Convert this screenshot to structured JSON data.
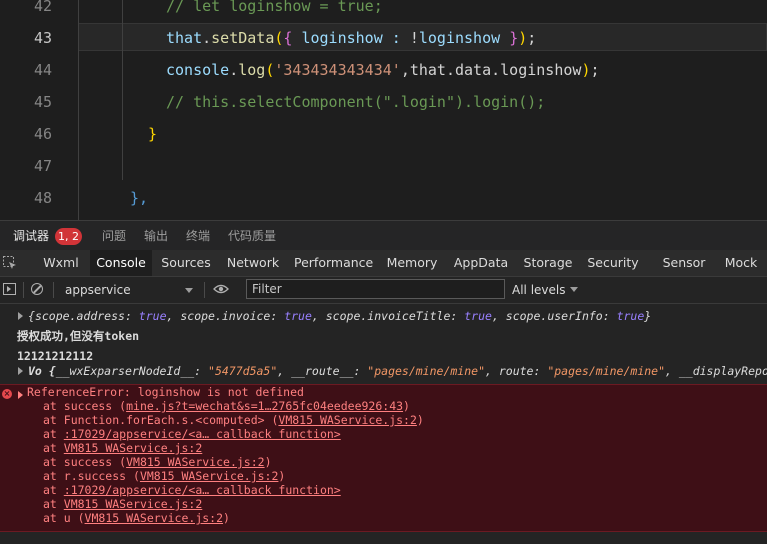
{
  "editor": {
    "line_numbers": [
      "42",
      "43",
      "44",
      "45",
      "46",
      "47",
      "48"
    ],
    "lines": {
      "l42": "// let loginshow = true;",
      "l43_that": "that",
      "l43_dot": ".",
      "l43_fn": "setData",
      "l43_open": "(",
      "l43_brace_open": "{",
      "l43_key": " loginshow : ",
      "l43_not": "!",
      "l43_val": "loginshow ",
      "l43_brace_close": "}",
      "l43_close": ")",
      "l43_semi": ";",
      "l44_console": "console",
      "l44_dot": ".",
      "l44_fn": "log",
      "l44_open": "(",
      "l44_str": "'343434343434'",
      "l44_rest": ",that.data.loginshow",
      "l44_close": ")",
      "l44_semi": ";",
      "l45": "// this.selectComponent(\".login\").login();",
      "l46": "}",
      "l48": "},"
    }
  },
  "panel_tabs": {
    "debugger": "调试器",
    "badge": "1, 2",
    "problems": "问题",
    "output": "输出",
    "terminal": "终端",
    "code_quality": "代码质量"
  },
  "dev_tabs": [
    "Wxml",
    "Console",
    "Sources",
    "Network",
    "Performance",
    "Memory",
    "AppData",
    "Storage",
    "Security",
    "Sensor",
    "Mock"
  ],
  "toolbar": {
    "context": "appservice",
    "filter_placeholder": "Filter",
    "levels": "All levels"
  },
  "console": {
    "msg1": {
      "open": "{",
      "k1": "scope.address: ",
      "v1": "true",
      "k2": ", scope.invoice: ",
      "v2": "true",
      "k3": ", scope.invoiceTitle: ",
      "v3": "true",
      "k4": ", scope.userInfo: ",
      "v4": "true",
      "close": "}"
    },
    "msg2": "授权成功,但没有token",
    "msg3": "12121212112",
    "msg4": {
      "prefix": "Vo {",
      "k1": "__wxExparserNodeId__: ",
      "v1": "\"5477d5a5\"",
      "k2": ", __route__: ",
      "v2": "\"pages/mine/mine\"",
      "k3": ", route: ",
      "v3": "\"pages/mine/mine\"",
      "k4": ", __displayReporter:"
    },
    "error": {
      "title": "ReferenceError: loginshow is not defined",
      "stack": [
        {
          "pre": "at success (",
          "link": "mine.js?t=wechat&s=1…2765fc04eedee926:43",
          "post": ")"
        },
        {
          "pre": "at Function.forEach.s.<computed> (",
          "link": "VM815 WAService.js:2",
          "post": ")"
        },
        {
          "pre": "at ",
          "link": ":17029/appservice/<a… callback function>",
          "post": ""
        },
        {
          "pre": "at ",
          "link": "VM815 WAService.js:2",
          "post": ""
        },
        {
          "pre": "at success (",
          "link": "VM815 WAService.js:2",
          "post": ")"
        },
        {
          "pre": "at r.success (",
          "link": "VM815 WAService.js:2",
          "post": ")"
        },
        {
          "pre": "at ",
          "link": ":17029/appservice/<a… callback function>",
          "post": ""
        },
        {
          "pre": "at ",
          "link": "VM815 WAService.js:2",
          "post": ""
        },
        {
          "pre": "at u (",
          "link": "VM815 WAService.js:2",
          "post": ")"
        }
      ]
    }
  },
  "colors": {
    "error_bg": "#3e0f16",
    "error_text": "#ff8080",
    "badge": "#d13438"
  }
}
